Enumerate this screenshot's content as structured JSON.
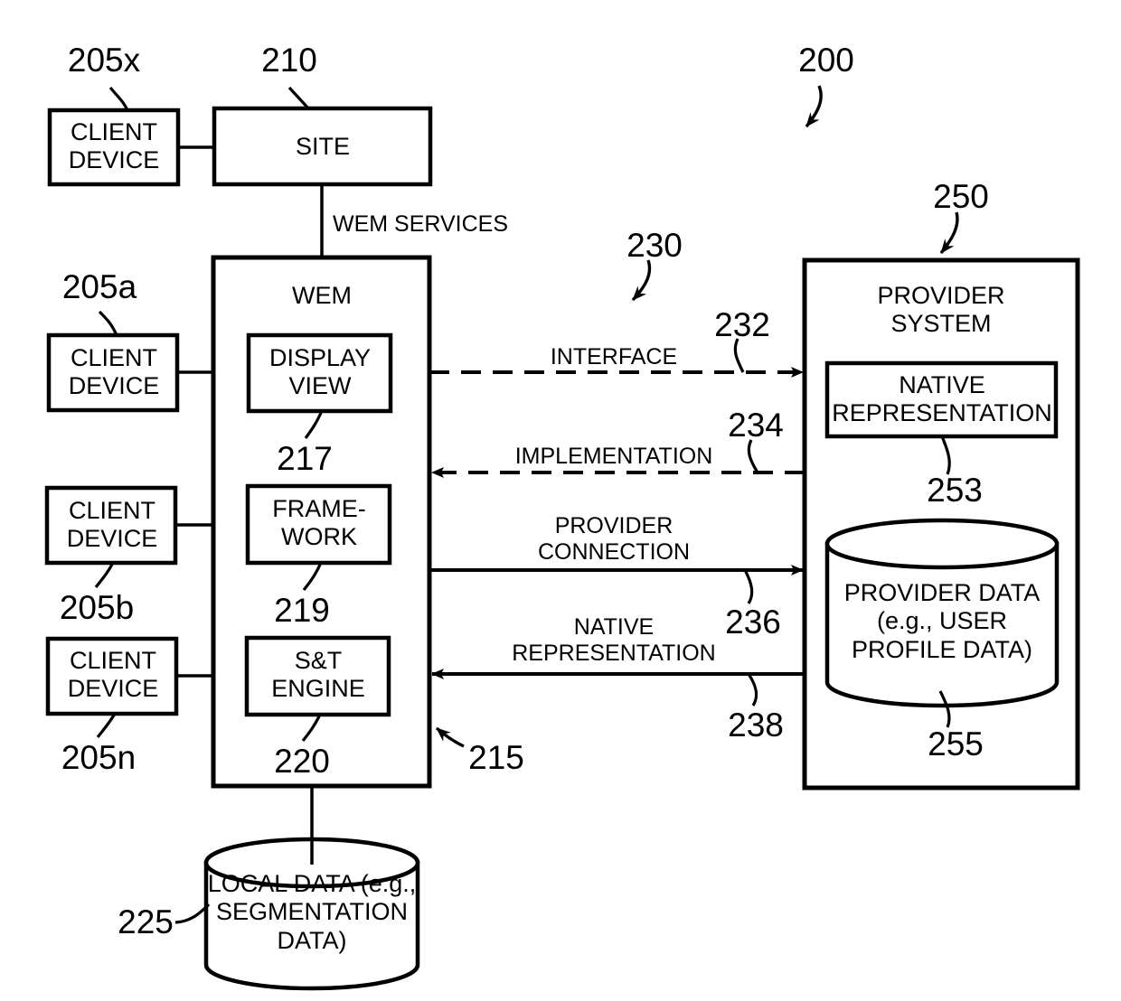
{
  "figure": {
    "ref_number": "200",
    "type": "patent-block-diagram"
  },
  "nodes": {
    "client_device_x": {
      "label": "CLIENT\nDEVICE",
      "ref": "205x"
    },
    "client_device_a": {
      "label": "CLIENT\nDEVICE",
      "ref": "205a"
    },
    "client_device_b": {
      "label": "CLIENT\nDEVICE",
      "ref": "205b"
    },
    "client_device_n": {
      "label": "CLIENT\nDEVICE",
      "ref": "205n"
    },
    "site": {
      "label": "SITE",
      "ref": "210"
    },
    "wem": {
      "label": "WEM",
      "ref": "215"
    },
    "display_view": {
      "label": "DISPLAY\nVIEW",
      "ref": "217"
    },
    "framework": {
      "label": "FRAME-\nWORK",
      "ref": "219"
    },
    "st_engine": {
      "label": "S&T\nENGINE",
      "ref": "220"
    },
    "local_data": {
      "label": "LOCAL DATA (e.g.,\nSEGMENTATION\nDATA)",
      "ref": "225"
    },
    "provider_system": {
      "label": "PROVIDER\nSYSTEM",
      "ref": "250"
    },
    "native_representation": {
      "label": "NATIVE\nREPRESENTATION",
      "ref": "253"
    },
    "provider_data": {
      "label": "PROVIDER DATA\n(e.g., USER\nPROFILE DATA)",
      "ref": "255"
    }
  },
  "connections": {
    "wem_services": {
      "label": "WEM SERVICES"
    },
    "group": {
      "ref": "230"
    },
    "interface": {
      "label": "INTERFACE",
      "ref": "232",
      "style": "dashed",
      "direction": "right"
    },
    "implementation": {
      "label": "IMPLEMENTATION",
      "ref": "234",
      "style": "dashed",
      "direction": "left"
    },
    "provider_connection": {
      "label": "PROVIDER\nCONNECTION",
      "ref": "236",
      "style": "solid",
      "direction": "right"
    },
    "native_representation_link": {
      "label": "NATIVE\nREPRESENTATION",
      "ref": "238",
      "style": "solid",
      "direction": "left"
    }
  },
  "colors": {
    "stroke": "#000000",
    "background": "#ffffff",
    "text": "#000000"
  }
}
